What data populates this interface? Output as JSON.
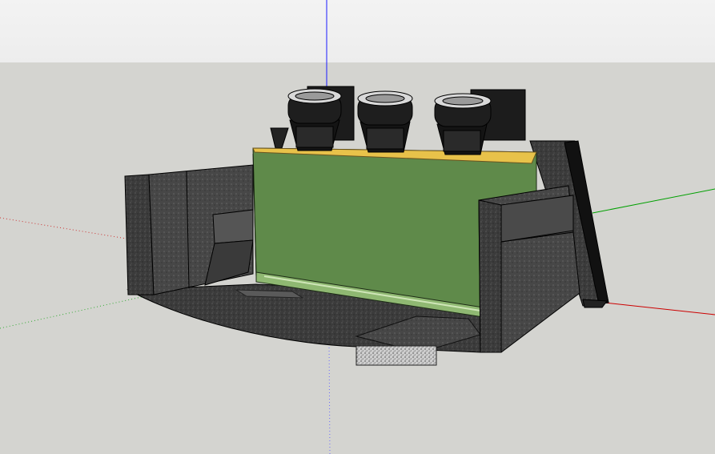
{
  "viewport": {
    "sky_color": "#eeeeee",
    "ground_color": "#d4d4d0",
    "axis_colors": {
      "red": "#cc0000",
      "green": "#00a000",
      "blue": "#1a1aff"
    }
  },
  "model": {
    "box_color": "#5f8a4a",
    "trim_color": "#e8c24a",
    "carpet_color": "#3d3d3d",
    "speaker_count": 3
  }
}
